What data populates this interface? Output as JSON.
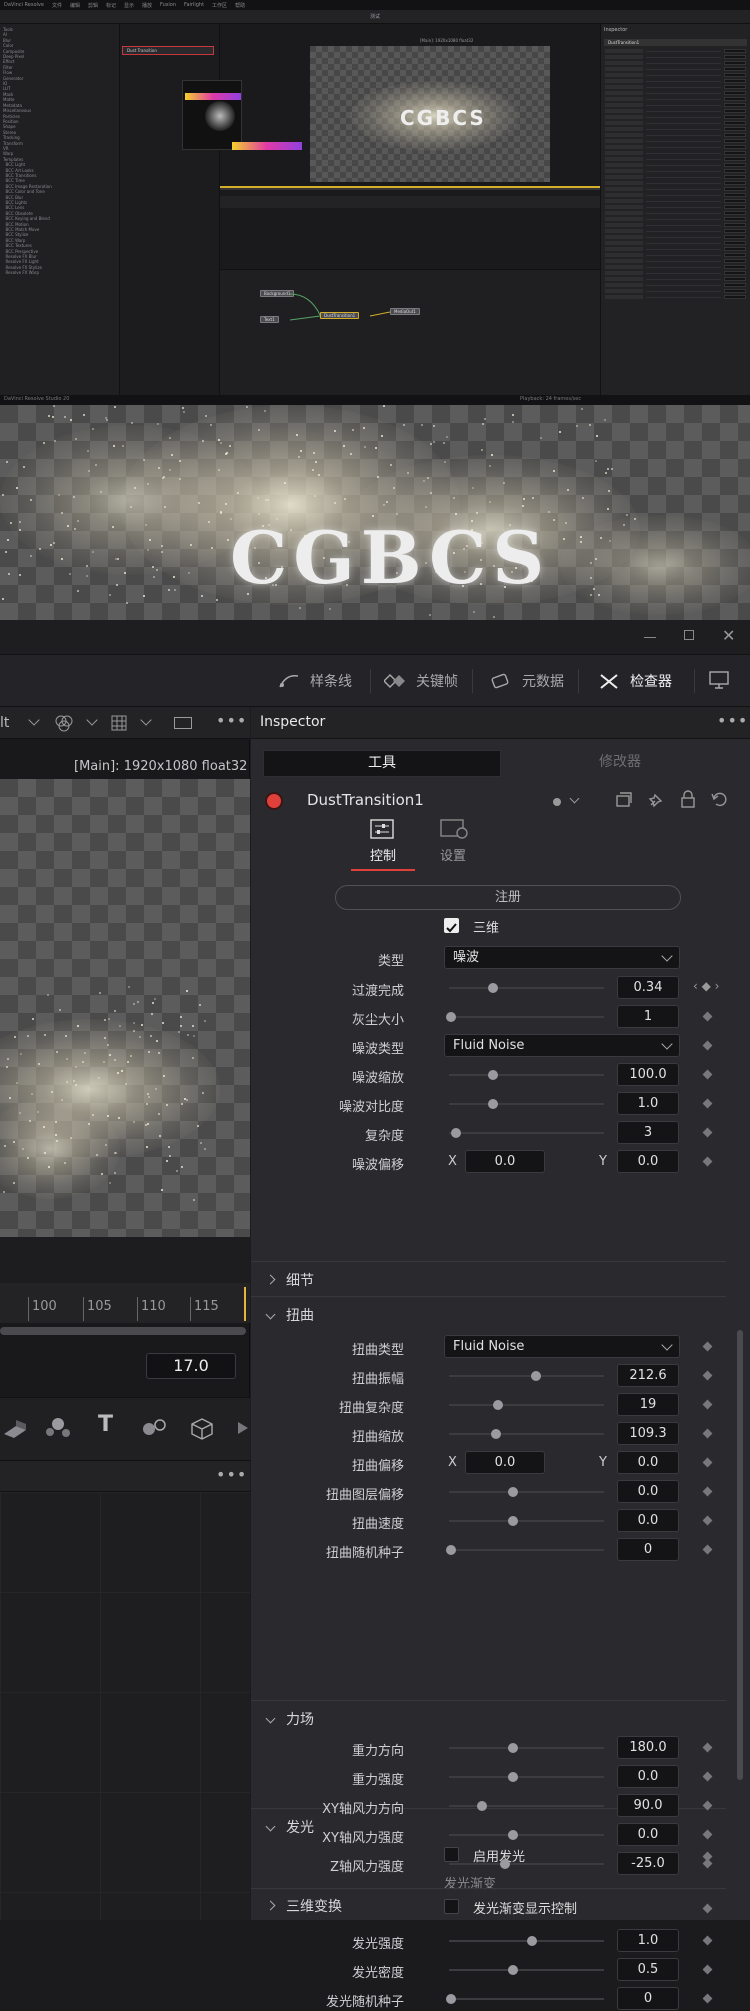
{
  "overview": {
    "menubar": [
      "DaVinci Resolve",
      "文件",
      "编辑",
      "剪辑",
      "标记",
      "显示",
      "播放",
      "Fusion",
      "Fairlight",
      "工作区",
      "帮助"
    ],
    "title": "测试",
    "fx_list": "Tools\nAI\nBlur\nColor\nComposite\nDeep Pixel\nEffect\nFilter\nFlow\nGenerator\nIO\nLUT\nMask\nMatte\nMetadata\nMiscellaneous\nParticles\nPosition\nShape\nStereo\nTracking\nTransform\nVR\nWarp\nTemplates\n  BCC Light\n  BCC Art Looks\n  BCC Transitions\n  BCC Time\n  BCC Image Restoration\n  BCC Color and Tone\n  BCC Blur\n  BCC Lights\n  BCC Lens\n  BCC Obsolete\n  BCC Keying and Blend\n  BCC Motion\n  BCC Match Move\n  BCC Stylize\n  BCC Warp\n  BCC Textures\n  BCC Perspective\n  Resolve FX Blur\n  Resolve FX Light\n  Resolve FX Stylize\n  Resolve FX Warp",
    "effect_item": "Dust Transition",
    "viewer_label": "[Main]: 1920x1080 float32",
    "inspector_title": "Inspector",
    "node_label": "DustTransition1",
    "nodes": [
      "Background1",
      "Text1",
      "DustTransition1",
      "MediaOut1"
    ],
    "footer_app": "DaVinci Resolve Studio 20",
    "playback": "Playback: 24 frames/sec"
  },
  "preview": {
    "text": "CGBCS"
  },
  "pagebar": {
    "spline": "样条线",
    "keyframes": "关键帧",
    "metadata": "元数据",
    "inspector": "检查器"
  },
  "viewer": {
    "left_fragment": "lt",
    "resolution": "[Main]: 1920x1080 float32",
    "ticks": [
      "100",
      "105",
      "110",
      "115"
    ],
    "frame": "17.0"
  },
  "inspector": {
    "title": "Inspector",
    "tab_tools": "工具",
    "tab_modifiers": "修改器",
    "node_name": "DustTransition1",
    "subtab_controls": "控制",
    "subtab_settings": "设置",
    "register": "注册",
    "three_d": "三维",
    "type_label": "类型",
    "type_value": "噪波",
    "rows": [
      {
        "label": "过渡完成",
        "value": "0.34",
        "pos": 0.27
      },
      {
        "label": "灰尘大小",
        "value": "1",
        "pos": 0.0
      },
      {
        "label": "噪波类型",
        "dropdown": "Fluid Noise"
      },
      {
        "label": "噪波缩放",
        "value": "100.0",
        "pos": 0.27
      },
      {
        "label": "噪波对比度",
        "value": "1.0",
        "pos": 0.27
      },
      {
        "label": "复杂度",
        "value": "3",
        "pos": 0.03
      },
      {
        "label": "噪波偏移",
        "x": "0.0",
        "y": "0.0"
      }
    ],
    "section_detail": "细节",
    "section_distort": "扭曲",
    "distort_rows": [
      {
        "label": "扭曲类型",
        "dropdown": "Fluid Noise"
      },
      {
        "label": "扭曲振幅",
        "value": "212.6",
        "pos": 0.55
      },
      {
        "label": "扭曲复杂度",
        "value": "19",
        "pos": 0.3
      },
      {
        "label": "扭曲缩放",
        "value": "109.3",
        "pos": 0.29
      },
      {
        "label": "扭曲偏移",
        "x": "0.0",
        "y": "0.0"
      },
      {
        "label": "扭曲图层偏移",
        "value": "0.0",
        "pos": 0.4
      },
      {
        "label": "扭曲速度",
        "value": "0.0",
        "pos": 0.4
      },
      {
        "label": "扭曲随机种子",
        "value": "0",
        "pos": 0.0
      }
    ],
    "section_glow": "发光",
    "glow_enable": "启用发光",
    "glow_gradient": "发光渐变",
    "glow_gradient_ctrl": "发光渐变显示控制",
    "glow_rows": [
      {
        "label": "发光强度",
        "value": "1.0",
        "pos": 0.52
      },
      {
        "label": "发光密度",
        "value": "0.5",
        "pos": 0.4
      },
      {
        "label": "发光随机种子",
        "value": "0",
        "pos": 0.0
      }
    ],
    "section_force": "力场",
    "force_rows": [
      {
        "label": "重力方向",
        "value": "180.0",
        "pos": 0.4
      },
      {
        "label": "重力强度",
        "value": "0.0",
        "pos": 0.4
      },
      {
        "label": "XY轴风力方向",
        "value": "90.0",
        "pos": 0.2
      },
      {
        "label": "XY轴风力强度",
        "value": "0.0",
        "pos": 0.4
      },
      {
        "label": "Z轴风力强度",
        "value": "-25.0",
        "pos": 0.35
      }
    ],
    "section_transform": "三维变换"
  },
  "colors": {
    "accent_red": "#e0403a",
    "accent_yellow": "#e8b33a",
    "tab_active_line": "#e0403a"
  }
}
